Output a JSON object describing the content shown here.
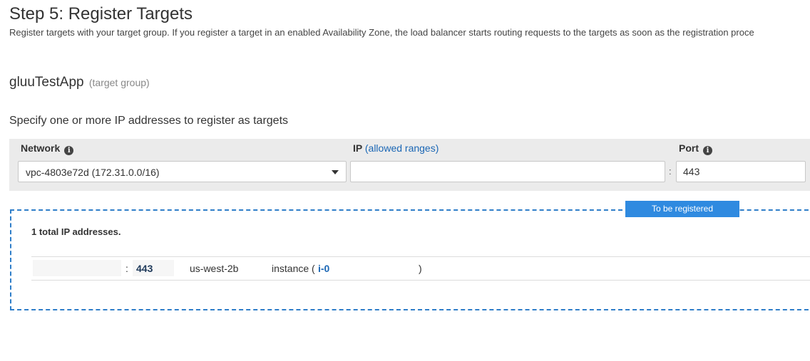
{
  "step": {
    "title": "Step 5: Register Targets",
    "description": "Register targets with your target group. If you register a target in an enabled Availability Zone, the load balancer starts routing requests to the targets as soon as the registration proce"
  },
  "target_group": {
    "name": "gluuTestApp",
    "suffix": "(target group)"
  },
  "specify_text": "Specify one or more IP addresses to register as targets",
  "form": {
    "network_label": "Network",
    "info_glyph": "i",
    "ip_label": "IP",
    "ip_ranges_link": "(allowed ranges)",
    "port_label": "Port",
    "network_value": "vpc-4803e72d (172.31.0.0/16)",
    "ip_value": "",
    "separator": ":",
    "port_value": "443"
  },
  "registration": {
    "badge": "To be registered",
    "total_text": "1 total IP addresses.",
    "row": {
      "separator": ":",
      "port": "443",
      "zone": "us-west-2b",
      "instance_prefix": "instance (",
      "instance_id": "i-0",
      "instance_suffix": ")"
    }
  },
  "colors": {
    "accent": "#2f8ae0",
    "link": "#1b67b5",
    "dashed_border": "#2f7ec9",
    "form_bg": "#ebebeb"
  },
  "icons": [
    "info-icon",
    "chevron-down-icon"
  ]
}
